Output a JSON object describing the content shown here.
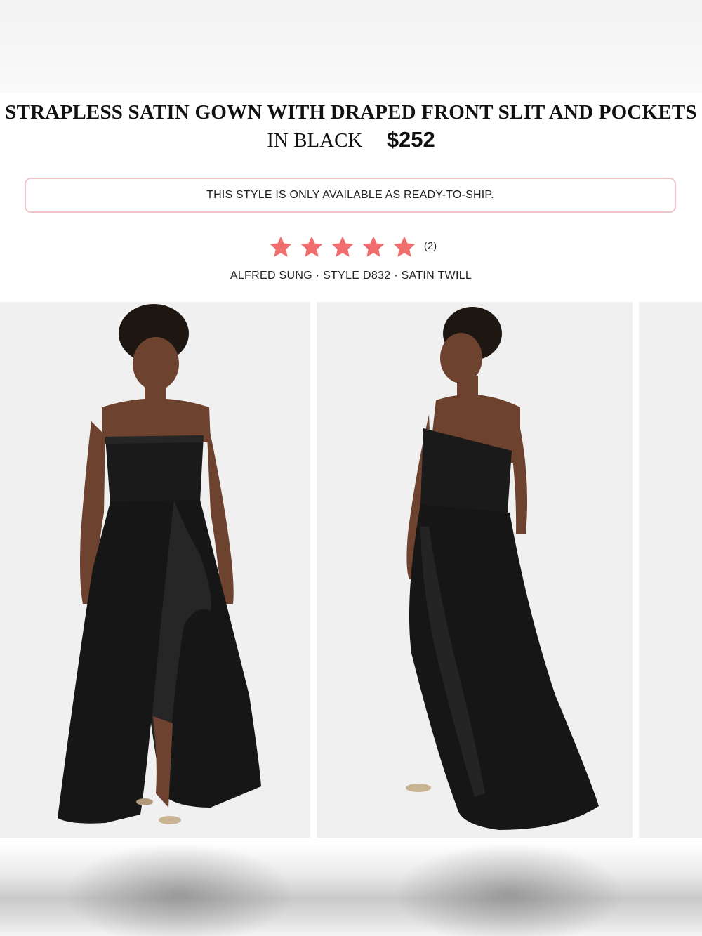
{
  "product": {
    "title_line1": "STRAPLESS SATIN GOWN WITH DRAPED FRONT SLIT AND POCKETS",
    "title_line2": "IN BLACK",
    "price": "$252"
  },
  "notice": {
    "text": "THIS STYLE IS ONLY AVAILABLE AS READY-TO-SHIP."
  },
  "rating": {
    "stars": 5,
    "max_stars": 5,
    "count": "(2)",
    "star_color": "#f06d6d",
    "icon": "star-icon"
  },
  "meta": {
    "text": "ALFRED SUNG · STYLE D832 · SATIN TWILL"
  },
  "colors": {
    "notice_border": "#f2c4cc",
    "photo_bg": "#f1f0f1",
    "gown": "#161616"
  }
}
